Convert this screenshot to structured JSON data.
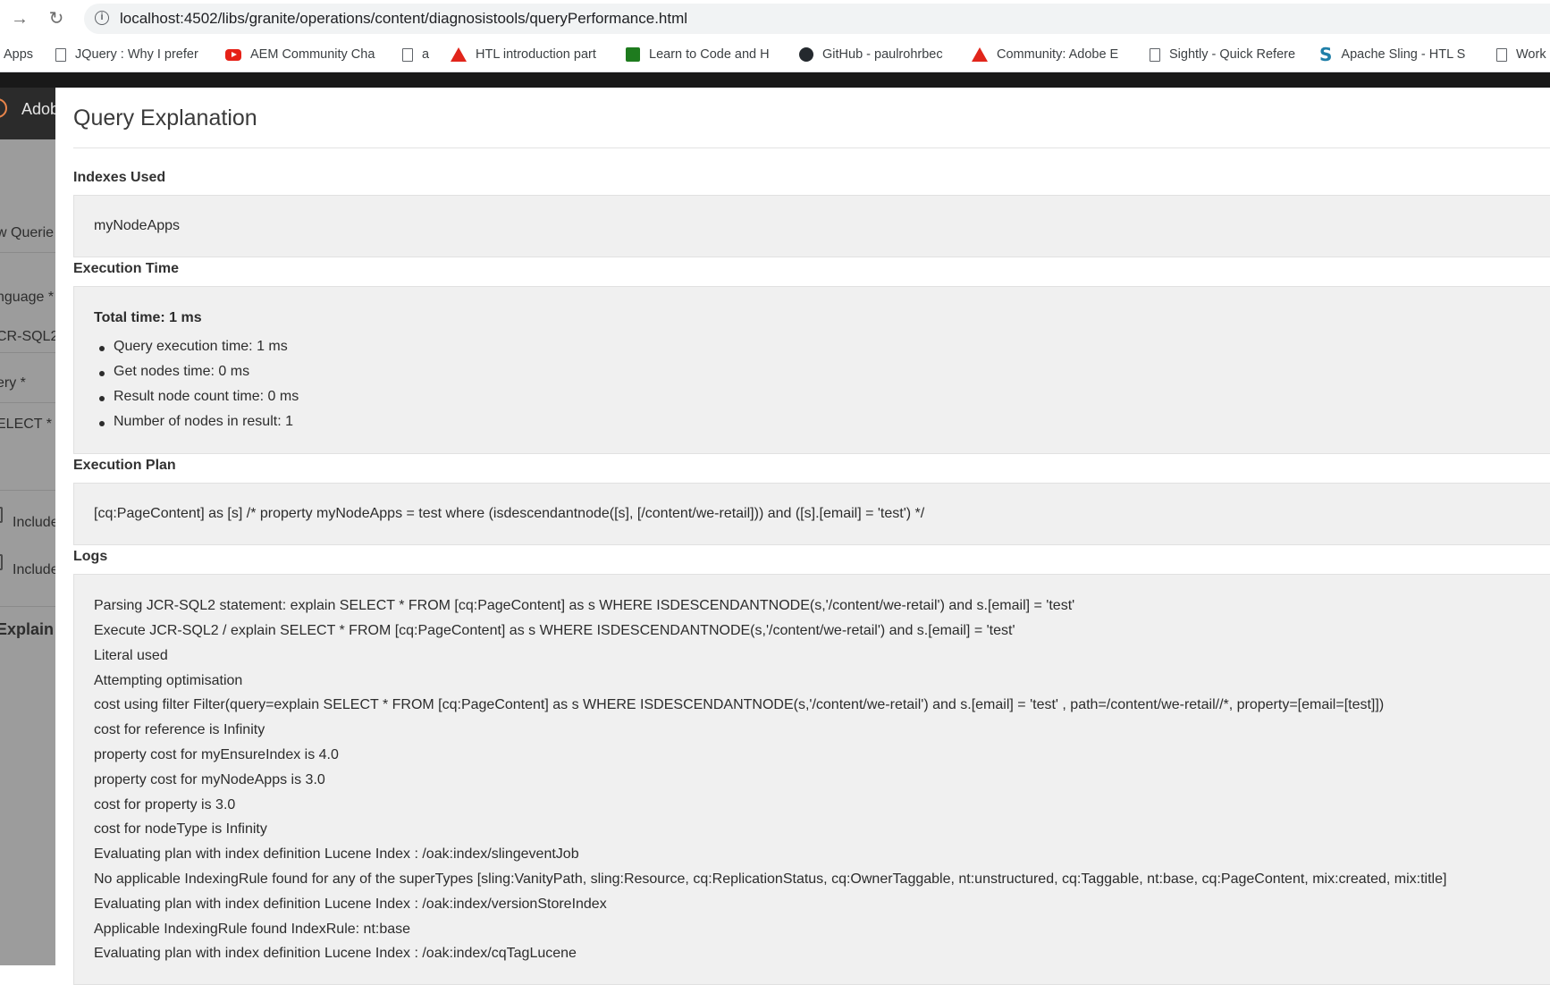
{
  "browser": {
    "url": "localhost:4502/libs/granite/operations/content/diagnosistools/queryPerformance.html",
    "bookmarks": [
      {
        "label": "Apps",
        "icon": "apps-icon"
      },
      {
        "label": "JQuery : Why I prefer",
        "icon": "page-icon"
      },
      {
        "label": "AEM Community Cha",
        "icon": "youtube-icon"
      },
      {
        "label": "a",
        "icon": "page-icon"
      },
      {
        "label": "HTL introduction part",
        "icon": "adobe-icon"
      },
      {
        "label": "Learn to Code and H",
        "icon": "code-icon"
      },
      {
        "label": "GitHub - paulrohrbec",
        "icon": "github-icon"
      },
      {
        "label": "Community: Adobe E",
        "icon": "adobe-icon"
      },
      {
        "label": "Sightly - Quick Refere",
        "icon": "page-icon"
      },
      {
        "label": "Apache Sling - HTL S",
        "icon": "sling-icon"
      },
      {
        "label": "Work",
        "icon": "page-icon"
      }
    ]
  },
  "aem": {
    "brand": "Adob"
  },
  "backdrop": {
    "new_queries": "w Querie",
    "language_label": "nguage *",
    "language_value": "CR-SQL2",
    "query_label": "ery *",
    "query_value": "ELECT *",
    "include1": "Include",
    "include2": "Include",
    "explain": "Explain"
  },
  "dialog": {
    "title": "Query Explanation",
    "indexes_label": "Indexes Used",
    "indexes_value": "myNodeApps",
    "execution_time_label": "Execution Time",
    "total_time": "Total time: 1 ms",
    "time_items": [
      "Query execution time: 1 ms",
      "Get nodes time: 0 ms",
      "Result node count time: 0 ms",
      "Number of nodes in result: 1"
    ],
    "plan_label": "Execution Plan",
    "plan_value": "[cq:PageContent] as [s] /* property myNodeApps = test where (isdescendantnode([s], [/content/we-retail])) and ([s].[email] = 'test') */",
    "logs_label": "Logs",
    "logs": [
      "Parsing JCR-SQL2 statement: explain SELECT * FROM [cq:PageContent] as s WHERE ISDESCENDANTNODE(s,'/content/we-retail') and s.[email] = 'test'",
      "Execute JCR-SQL2 / explain SELECT * FROM [cq:PageContent] as s WHERE ISDESCENDANTNODE(s,'/content/we-retail') and s.[email] = 'test'",
      "Literal used",
      "Attempting optimisation",
      "cost using filter Filter(query=explain SELECT * FROM [cq:PageContent] as s WHERE ISDESCENDANTNODE(s,'/content/we-retail') and s.[email] = 'test' , path=/content/we-retail//*, property=[email=[test]])",
      "cost for reference is Infinity",
      "property cost for myEnsureIndex is 4.0",
      "property cost for myNodeApps is 3.0",
      "cost for property is 3.0",
      "cost for nodeType is Infinity",
      "Evaluating plan with index definition Lucene Index : /oak:index/slingeventJob",
      "No applicable IndexingRule found for any of the superTypes [sling:VanityPath, sling:Resource, cq:ReplicationStatus, cq:OwnerTaggable, nt:unstructured, cq:Taggable, nt:base, cq:PageContent, mix:created, mix:title]",
      "Evaluating plan with index definition Lucene Index : /oak:index/versionStoreIndex",
      "Applicable IndexingRule found IndexRule: nt:base",
      "Evaluating plan with index definition Lucene Index : /oak:index/cqTagLucene"
    ]
  }
}
